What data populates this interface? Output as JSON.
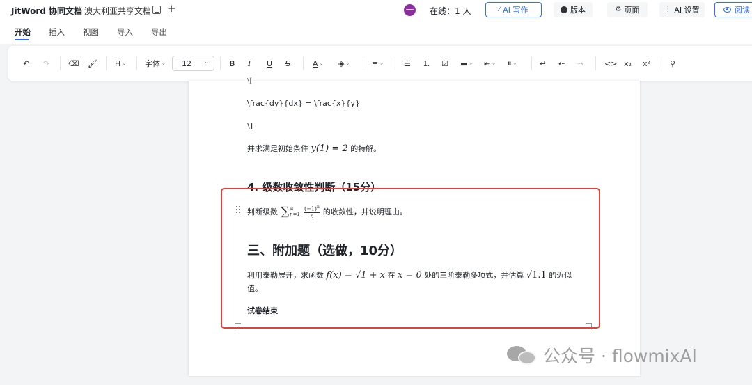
{
  "header": {
    "app_title": "JitWord 协同文档",
    "doc_title": "澳大利亚共享文档",
    "online": "在线：1 人",
    "ai_write": "AI 写作",
    "version": "版本",
    "page": "页面",
    "ai_settings": "AI 设置",
    "read": "阅读"
  },
  "tabs": [
    "开始",
    "插入",
    "视图",
    "导入",
    "导出"
  ],
  "toolbar": {
    "heading": "H",
    "font_family": "字体",
    "font_size": "12",
    "bold": "B",
    "italic": "I",
    "underline": "U",
    "strike": "S",
    "text_color": "A",
    "code": "<>",
    "subscript": "x₂",
    "superscript": "x²"
  },
  "document": {
    "line_open_bracket": "\\[",
    "latex_line": "\\frac{dy}{dx} = \\frac{x}{y}",
    "line_close_bracket": "\\]",
    "condition_prefix": "并求满足初始条件",
    "condition_math": "y(1) = 2",
    "condition_suffix": "的特解。",
    "section4_title": "4. 级数收敛性判断（15分）",
    "series_prefix": "判断级数",
    "series_suffix": "的收敛性，并说明理由。",
    "section3_title": "三、附加题（选做，10分）",
    "taylor_prefix": "利用泰勒展开，求函数",
    "taylor_func": "f(x) = √1 + x",
    "taylor_mid1": "在",
    "taylor_point": "x = 0",
    "taylor_mid2": "处的三阶泰勒多项式，并估算",
    "taylor_est": "√1.1",
    "taylor_suffix": "的近似",
    "taylor_wrap": "值。",
    "end_text": "试卷结束"
  },
  "watermark": {
    "text": "公众号 · flowmixAI"
  },
  "colors": {
    "accent": "#2f6bff",
    "highlight": "#e0433b"
  }
}
